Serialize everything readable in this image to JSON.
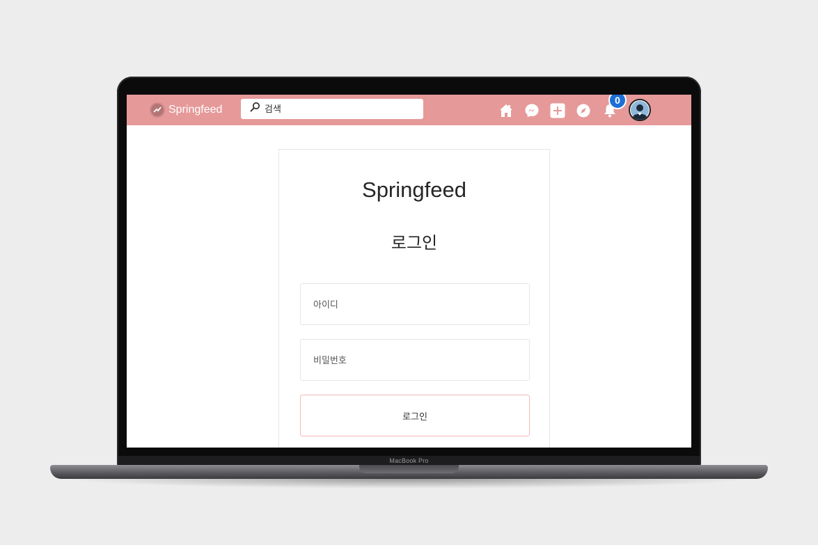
{
  "device": {
    "label": "MacBook Pro"
  },
  "navbar": {
    "brand": "Springfeed",
    "search": {
      "placeholder": "검색",
      "icon": "magnifier-icon"
    },
    "icons": [
      "home-icon",
      "messenger-icon",
      "add-post-icon",
      "explore-compass-icon",
      "notification-bell-icon"
    ],
    "notification_count": "0",
    "background_color": "#e69999"
  },
  "login": {
    "title": "Springfeed",
    "subtitle": "로그인",
    "username_placeholder": "아이디",
    "password_placeholder": "비밀번호",
    "submit_label": "로그인"
  }
}
